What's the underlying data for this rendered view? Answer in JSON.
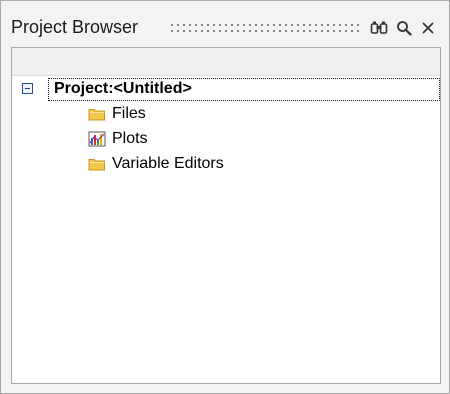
{
  "window": {
    "title": "Project Browser",
    "toolbar_icons": [
      "find-icon",
      "search-icon",
      "close-icon"
    ]
  },
  "tree": {
    "root": {
      "label": "Project:<Untitled>",
      "expanded": true,
      "expander_icon": "collapse-minus-icon"
    },
    "children": [
      {
        "label": "Files",
        "icon": "folder-icon"
      },
      {
        "label": "Plots",
        "icon": "plots-icon"
      },
      {
        "label": "Variable Editors",
        "icon": "folder-icon"
      }
    ]
  },
  "colors": {
    "folder": "#f2c94c",
    "folder_dark": "#c8961e",
    "selection_border": "#1a1a1a",
    "expander_border": "#2a4f8a"
  }
}
